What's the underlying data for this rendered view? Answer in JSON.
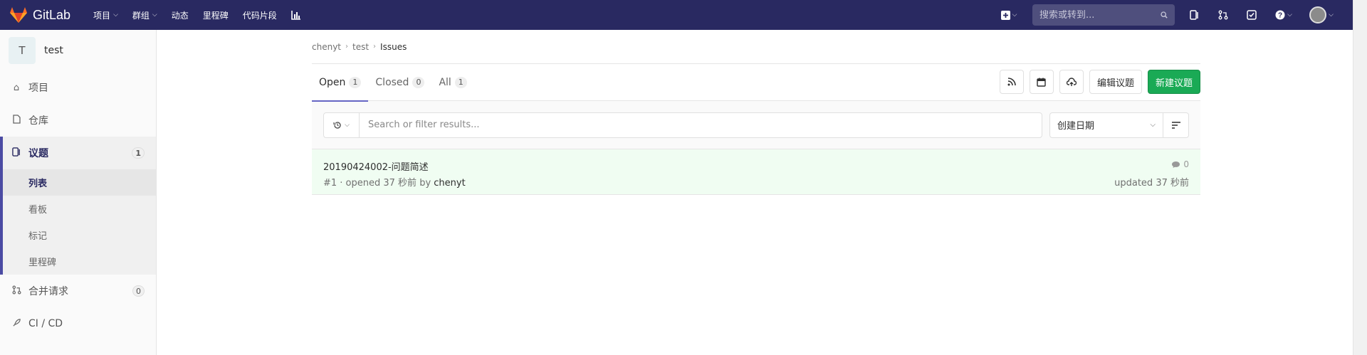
{
  "navbar": {
    "brand": "GitLab",
    "menu": [
      {
        "label": "项目",
        "dropdown": true
      },
      {
        "label": "群组",
        "dropdown": true
      },
      {
        "label": "动态",
        "dropdown": false
      },
      {
        "label": "里程碑",
        "dropdown": false
      },
      {
        "label": "代码片段",
        "dropdown": false
      }
    ],
    "search_placeholder": "搜索或转到..."
  },
  "sidebar": {
    "project_initial": "T",
    "project_name": "test",
    "items": {
      "project": "项目",
      "repository": "仓库",
      "issues": "议题",
      "issues_count": "1",
      "merge_requests": "合并请求",
      "merge_requests_count": "0",
      "cicd": "CI / CD"
    },
    "issue_sub": [
      "列表",
      "看板",
      "标记",
      "里程碑"
    ]
  },
  "breadcrumb": [
    "chenyt",
    "test",
    "Issues"
  ],
  "tabs": [
    {
      "label": "Open",
      "count": "1"
    },
    {
      "label": "Closed",
      "count": "0"
    },
    {
      "label": "All",
      "count": "1"
    }
  ],
  "actions": {
    "edit_issues": "编辑议题",
    "new_issue": "新建议题"
  },
  "filter": {
    "placeholder": "Search or filter results...",
    "sort_label": "创建日期"
  },
  "issues": [
    {
      "title": "20190424002-问题简述",
      "meta_prefix": "#1 · opened 37 秒前 by ",
      "author": "chenyt",
      "comments": "0",
      "updated": "updated 37 秒前"
    }
  ],
  "colors": {
    "navbar": "#292961",
    "primary_button": "#1aaa55",
    "active_tab": "#6666c4",
    "issue_row": "#f0fdf2"
  }
}
